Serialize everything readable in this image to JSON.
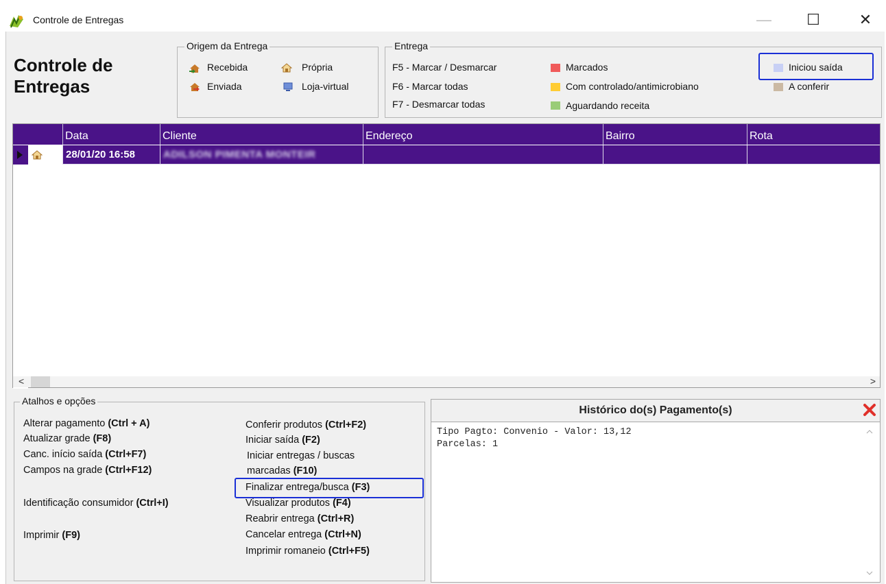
{
  "window": {
    "title": "Controle de Entregas",
    "icons": {
      "app": "app-logo-icon",
      "minimize": "minimize-icon",
      "maximize": "maximize-icon",
      "close": "close-icon"
    },
    "minimize_glyph": "—",
    "maximize_glyph": "☐",
    "close_glyph": "✕"
  },
  "header": {
    "title_line1": "Controle de",
    "title_line2": "Entregas"
  },
  "origem": {
    "caption": "Origem da Entrega",
    "items": [
      {
        "label": "Recebida",
        "icon": "incoming-house-icon"
      },
      {
        "label": "Própria",
        "icon": "own-house-icon"
      },
      {
        "label": "Enviada",
        "icon": "outgoing-house-icon"
      },
      {
        "label": "Loja-virtual",
        "icon": "computer-icon"
      }
    ]
  },
  "entrega": {
    "caption": "Entrega",
    "shortcuts": [
      "F5 - Marcar / Desmarcar",
      "F6 - Marcar todas",
      "F7 - Desmarcar todas"
    ],
    "legend": [
      {
        "label": "Marcados",
        "color": "#f05a5a"
      },
      {
        "label": "Com controlado/antimicrobiano",
        "color": "#ffcc33"
      },
      {
        "label": "Aguardando receita",
        "color": "#99cc77"
      },
      {
        "label": "Iniciou saída",
        "color": "#c8d0f5"
      },
      {
        "label": "A conferir",
        "color": "#cbb9a3"
      }
    ]
  },
  "grid": {
    "columns": [
      "Data",
      "Cliente",
      "Endereço",
      "Bairro",
      "Rota"
    ],
    "header_color": "#4a1388",
    "rows": [
      {
        "icon": "own-house-icon",
        "data": "28/01/20 16:58",
        "cliente": "ADILSON PIMENTA MONTEIR",
        "endereco": "",
        "bairro": "",
        "rota": ""
      }
    ],
    "scroll_left": "<",
    "scroll_right": ">"
  },
  "atalhos": {
    "caption": "Atalhos e opções",
    "left": [
      {
        "label": "Alterar pagamento",
        "key": "(Ctrl + A)"
      },
      {
        "label": "Atualizar grade",
        "key": "(F8)"
      },
      {
        "label": "Canc. início saída",
        "key": "(Ctrl+F7)"
      },
      {
        "label": "Campos na grade",
        "key": "(Ctrl+F12)"
      },
      {
        "label": "Identificação consumidor",
        "key": "(Ctrl+I)"
      },
      {
        "label": "Imprimir",
        "key": "(F9)"
      }
    ],
    "right": [
      {
        "label": "Conferir produtos",
        "key": "(Ctrl+F2)"
      },
      {
        "label": "Iniciar saída",
        "key": "(F2)"
      },
      {
        "label": "Iniciar entregas / buscas",
        "key": ""
      },
      {
        "label": "marcadas",
        "key": "(F10)"
      },
      {
        "label": "Finalizar entrega/busca",
        "key": "(F3)"
      },
      {
        "label": "Visualizar produtos",
        "key": "(F4)"
      },
      {
        "label": "Reabrir entrega",
        "key": "(Ctrl+R)"
      },
      {
        "label": "Cancelar entrega",
        "key": "(Ctrl+N)"
      },
      {
        "label": "Imprimir romaneio",
        "key": "(Ctrl+F5)"
      }
    ]
  },
  "historico": {
    "title": "Histórico do(s) Pagamento(s)",
    "lines": [
      "Tipo Pagto: Convenio - Valor: 13,12",
      "Parcelas: 1"
    ]
  }
}
